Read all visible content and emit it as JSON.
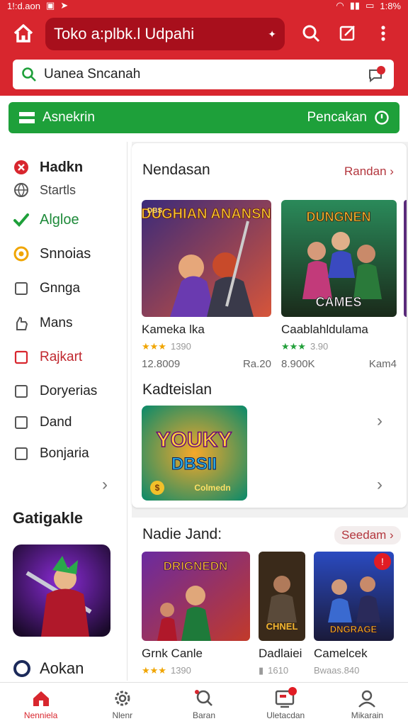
{
  "status": {
    "time": "1!:d.aon",
    "battery": "1:8%"
  },
  "header": {
    "title": "Toko a:plbk.l Udpahi",
    "colors": {
      "bar": "#d8262e",
      "pill": "#a80f1c"
    }
  },
  "search": {
    "value": "Uanea Sncanah"
  },
  "banner": {
    "left_label": "Asnekrin",
    "right_label": "Pencakan",
    "color": "#1ea03a"
  },
  "sidebar": {
    "items": [
      {
        "label": "Hadkn",
        "icon": "x-circle-icon",
        "color": "#d8262e"
      },
      {
        "label": "Startls",
        "icon": "globe-icon",
        "color": "#555"
      },
      {
        "label": "Algloe",
        "icon": "check-icon",
        "color": "#1ea03a"
      },
      {
        "label": "Snnoias",
        "icon": "target-icon",
        "color": "#f0a500"
      },
      {
        "label": "Gnnga",
        "icon": "square-icon",
        "color": "#555"
      },
      {
        "label": "Mans",
        "icon": "hand-icon",
        "color": "#555"
      },
      {
        "label": "Rajkart",
        "icon": "square-icon",
        "color": "#d8262e"
      },
      {
        "label": "Doryerias",
        "icon": "square-icon",
        "color": "#555"
      },
      {
        "label": "Dand",
        "icon": "square-icon",
        "color": "#555"
      },
      {
        "label": "Bonjaria",
        "icon": "square-icon",
        "color": "#555"
      }
    ],
    "section_title": "Gatigakle",
    "bottom_label": "Aokan"
  },
  "content": {
    "section1": {
      "title": "Nendasan",
      "link": "Randan",
      "games": [
        {
          "art_title": "DUGHIAN ANANSN",
          "art_tag": "DBS",
          "name": "Kameka lka",
          "stars": "★★★",
          "rating": "1390",
          "downloads": "12.8009",
          "price": "Ra.20"
        },
        {
          "art_title": "DUNGNEN",
          "art_sub": "CAMES",
          "name": "Caablahldulama",
          "stars": "★★★",
          "rating": "3.90",
          "downloads": "8.900K",
          "price": "Kam4"
        }
      ]
    },
    "section2": {
      "title": "Kadteislan",
      "banner_art": {
        "big": "YOUKY",
        "mid": "DBSII",
        "tag": "Colmedn",
        "coin": "$"
      }
    },
    "section3": {
      "title": "Nadie Jand:",
      "link": "Seedam",
      "games": [
        {
          "art_title": "DRIGNEDN",
          "name": "Grnk Canle",
          "stars": "★★★",
          "rating": "1390"
        },
        {
          "art_title": "CHNEL",
          "name": "Dadlaiei",
          "stars": "▮",
          "rating": "1610"
        },
        {
          "art_title": "DNGRAGE",
          "name": "Camelcek",
          "stars": "",
          "rating": "Bwaas.840",
          "badge": "!"
        }
      ]
    }
  },
  "bottom_nav": [
    {
      "label": "Nenniela",
      "icon": "home-icon",
      "active": true
    },
    {
      "label": "Nlenr",
      "icon": "gear-icon",
      "active": false
    },
    {
      "label": "Baran",
      "icon": "search-icon",
      "active": false
    },
    {
      "label": "Uletacdan",
      "icon": "screen-icon",
      "active": false,
      "badge": true
    },
    {
      "label": "Mikarain",
      "icon": "user-icon",
      "active": false
    }
  ]
}
